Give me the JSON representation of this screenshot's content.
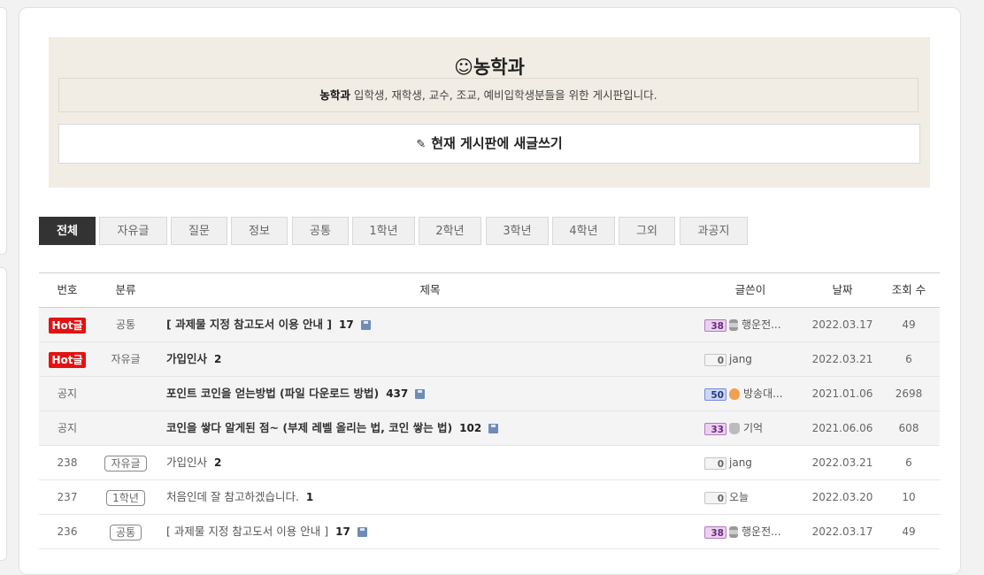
{
  "board": {
    "title": "☺농학과",
    "desc_bold": "농학과",
    "desc_rest": " 입학생, 재학생, 교수, 조교, 예비입학생분들을 위한 게시판입니다.",
    "write_label": "현재 게시판에 새글쓰기"
  },
  "tabs": [
    "전체",
    "자유글",
    "질문",
    "정보",
    "공통",
    "1학년",
    "2학년",
    "3학년",
    "4학년",
    "그외",
    "과공지"
  ],
  "table": {
    "headers": {
      "num": "번호",
      "cat": "분류",
      "title": "제목",
      "writer": "글쓴이",
      "date": "날짜",
      "views": "조회 수"
    },
    "rows": [
      {
        "num": "Hot글",
        "cat": "공통",
        "title": "[ 과제물 지정 참고도서 이용 안내 ]",
        "count": "17",
        "level": "38",
        "writer": "행운전...",
        "date": "2022.03.17",
        "views": "49"
      },
      {
        "num": "Hot글",
        "cat": "자유글",
        "title": "가입인사",
        "count": "2",
        "level": "0",
        "writer": "jang",
        "date": "2022.03.21",
        "views": "6"
      },
      {
        "num": "공지",
        "cat": "",
        "title": "포인트 코인을 얻는방법 (파일 다운로드 방법)",
        "count": "437",
        "level": "50",
        "writer": "방송대...",
        "date": "2021.01.06",
        "views": "2698"
      },
      {
        "num": "공지",
        "cat": "",
        "title": "코인을 쌓다 알게된 점~ (부제 레벨 올리는 법, 코인 쌓는 법)",
        "count": "102",
        "level": "33",
        "writer": "기억",
        "date": "2021.06.06",
        "views": "608"
      },
      {
        "num": "238",
        "cat": "자유글",
        "title": "가입인사",
        "count": "2",
        "level": "0",
        "writer": "jang",
        "date": "2022.03.21",
        "views": "6"
      },
      {
        "num": "237",
        "cat": "1학년",
        "title": "처음인데 잘 참고하겠습니다.",
        "count": "1",
        "level": "0",
        "writer": "오늘",
        "date": "2022.03.20",
        "views": "10"
      },
      {
        "num": "236",
        "cat": "공통",
        "title": "[ 과제물 지정 참고도서 이용 안내 ]",
        "count": "17",
        "level": "38",
        "writer": "행운전...",
        "date": "2022.03.17",
        "views": "49"
      }
    ]
  },
  "colors": {
    "hot": "#e21313",
    "panel": "#f1ede4",
    "active_tab": "#333333"
  },
  "icons": {
    "write": "pencil-icon",
    "attachment": "floppy-disk-icon"
  }
}
